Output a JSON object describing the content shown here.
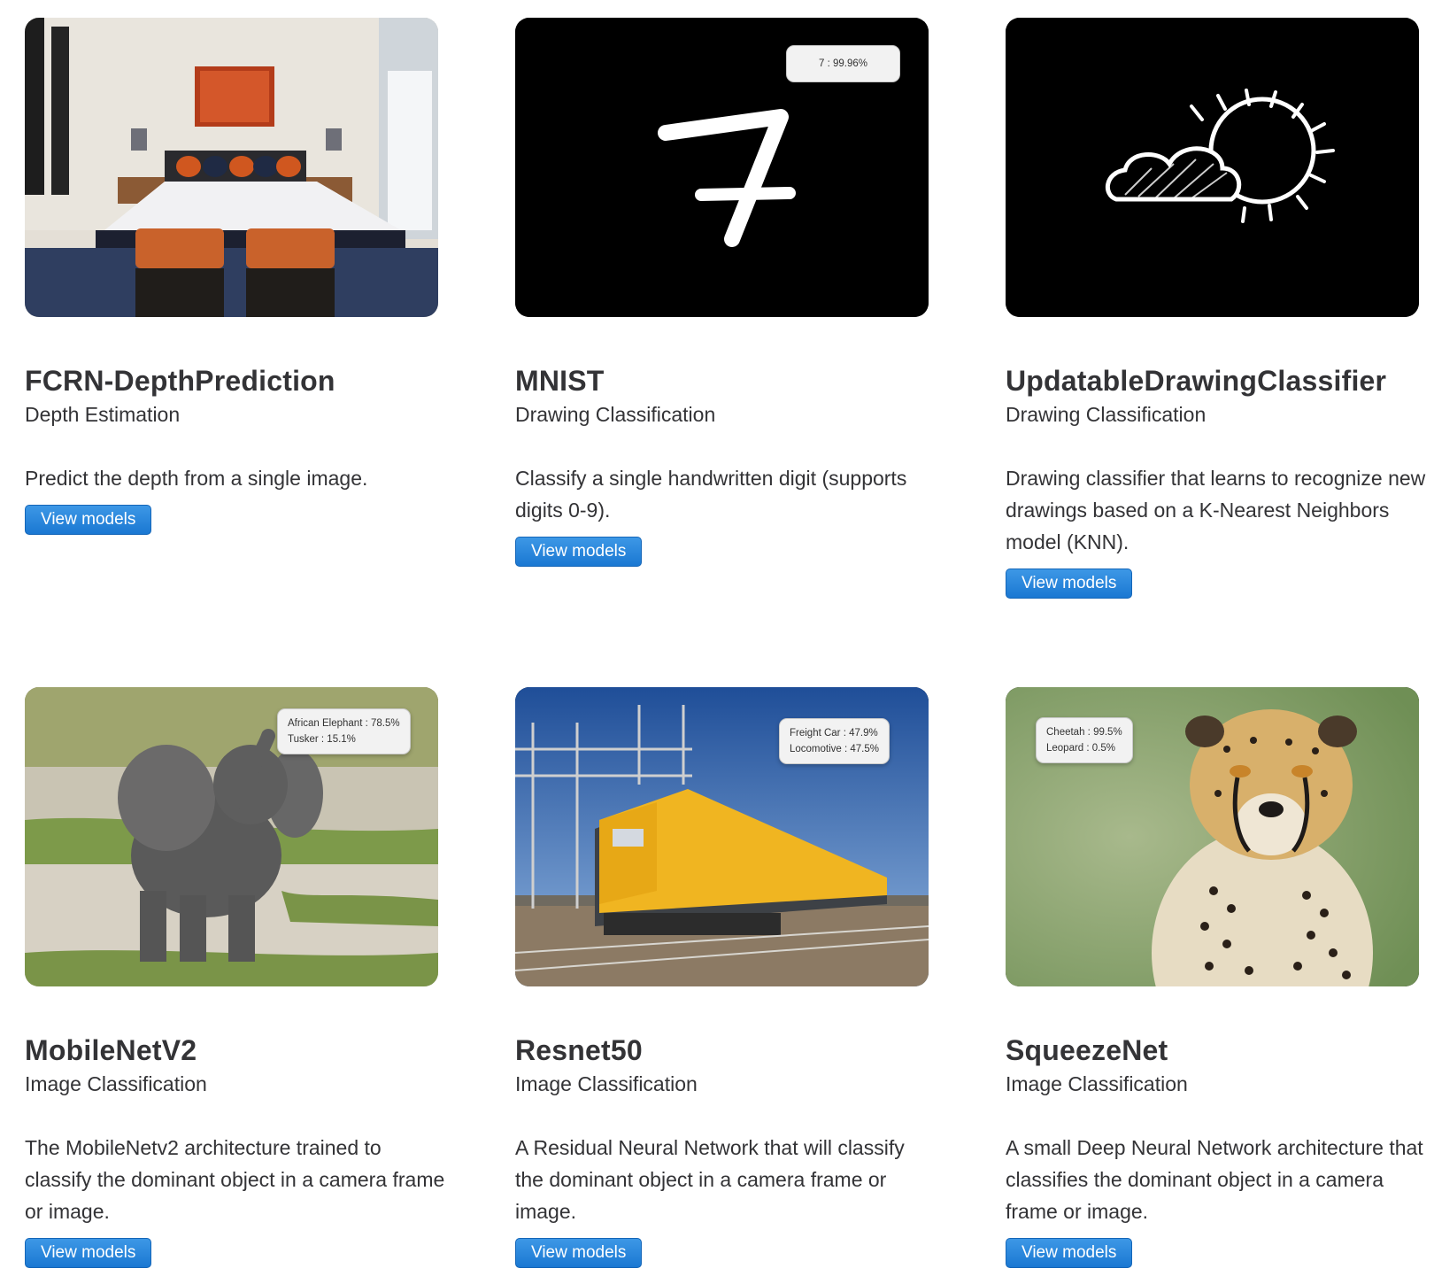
{
  "cards": [
    {
      "title": "FCRN-DepthPrediction",
      "category": "Depth Estimation",
      "description": "Predict the depth from a single image.",
      "button": "View models",
      "image": "bedroom-photo",
      "prediction": []
    },
    {
      "title": "MNIST",
      "category": "Drawing Classification",
      "description": "Classify a single handwritten digit (supports digits 0-9).",
      "button": "View models",
      "image": "handwritten-seven",
      "prediction": [
        "7 : 99.96%"
      ]
    },
    {
      "title": "UpdatableDrawingClassifier",
      "category": "Drawing Classification",
      "description": "Drawing classifier that learns to recognize new drawings based on a K-Nearest Neighbors model (KNN).",
      "button": "View models",
      "image": "cloud-sun-sketch",
      "prediction": []
    },
    {
      "title": "MobileNetV2",
      "category": "Image Classification",
      "description": "The MobileNetv2 architecture trained to classify the dominant object in a camera frame or image.",
      "button": "View models",
      "image": "elephant-photo",
      "prediction": [
        "African Elephant : 78.5%",
        "Tusker : 15.1%"
      ]
    },
    {
      "title": "Resnet50",
      "category": "Image Classification",
      "description": "A Residual Neural Network that will classify the dominant object in a camera frame or image.",
      "button": "View models",
      "image": "train-photo",
      "prediction": [
        "Freight Car : 47.9%",
        "Locomotive : 47.5%"
      ]
    },
    {
      "title": "SqueezeNet",
      "category": "Image Classification",
      "description": "A small Deep Neural Network architecture that classifies the dominant object in a camera frame or image.",
      "button": "View models",
      "image": "cheetah-photo",
      "prediction": [
        "Cheetah : 99.5%",
        "Leopard : 0.5%"
      ]
    }
  ]
}
